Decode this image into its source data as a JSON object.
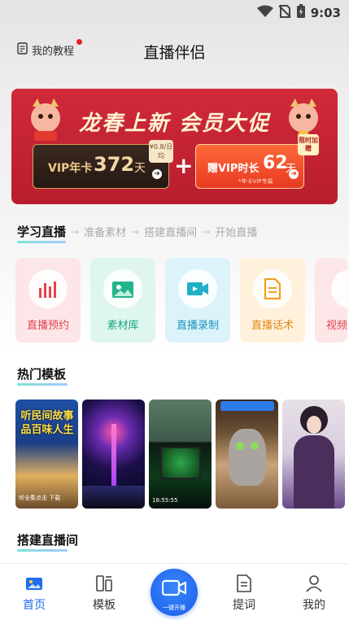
{
  "status_bar": {
    "time": "9:03"
  },
  "header": {
    "tutorial_label": "我的教程",
    "title": "直播伴侣"
  },
  "banner": {
    "title": "龙春上新 会员大促",
    "vip_card": {
      "label": "VIP年卡",
      "number": "372",
      "unit": "天",
      "price_tag": "¥0.8/日均"
    },
    "plus": "+",
    "bonus_card": {
      "label": "赠VIP时长",
      "number": "62",
      "unit": "天",
      "sub": "*年卡VIP专属"
    },
    "badge": "限时加赠"
  },
  "steps": {
    "active": "学习直播",
    "items": [
      "准备素材",
      "搭建直播间",
      "开始直播"
    ],
    "arrow": "→"
  },
  "tools": [
    {
      "label": "直播预约",
      "icon": "bar-chart-icon"
    },
    {
      "label": "素材库",
      "icon": "image-icon"
    },
    {
      "label": "直播录制",
      "icon": "video-camera-icon"
    },
    {
      "label": "直播话术",
      "icon": "document-icon"
    },
    {
      "label": "视频",
      "icon": "video-icon"
    }
  ],
  "sections": {
    "hot_templates": "热门模板",
    "build_room": "搭建直播间"
  },
  "templates": [
    {
      "caption": "听民间故事品百味人生",
      "footer": "听全集点击 下载"
    },
    {
      "caption": ""
    },
    {
      "caption": "",
      "time": "18:55:55"
    },
    {
      "caption": ""
    },
    {
      "caption": ""
    }
  ],
  "bottom_nav": {
    "items": [
      {
        "label": "首页",
        "icon": "home-icon",
        "active": true
      },
      {
        "label": "模板",
        "icon": "template-icon",
        "active": false
      },
      {
        "label": "提词",
        "icon": "prompter-icon",
        "active": false
      },
      {
        "label": "我的",
        "icon": "profile-icon",
        "active": false
      }
    ],
    "center": {
      "label": "一键开播",
      "icon": "camera-icon"
    }
  },
  "colors": {
    "accent": "#1f6cf0",
    "banner": "#c8283a",
    "red_dot": "#e8202a"
  }
}
